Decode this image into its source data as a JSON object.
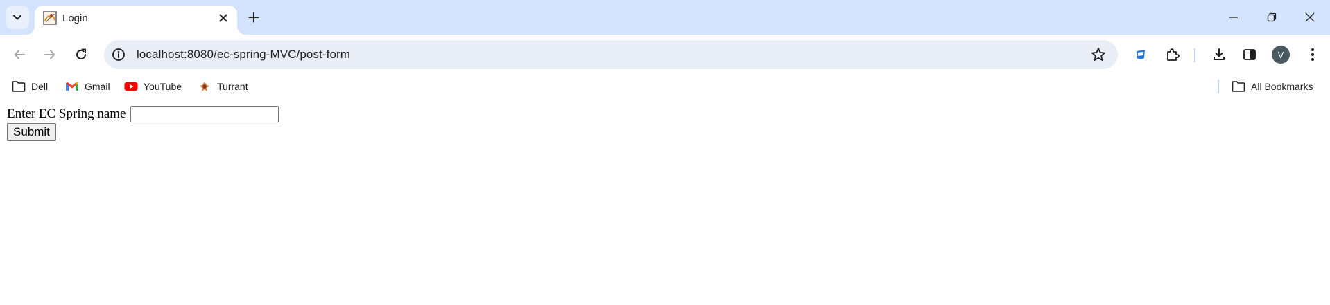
{
  "tab": {
    "title": "Login"
  },
  "omnibox": {
    "url": "localhost:8080/ec-spring-MVC/post-form"
  },
  "profile": {
    "initial": "V"
  },
  "bookmarks": {
    "items": [
      {
        "label": "Dell",
        "icon": "folder-icon"
      },
      {
        "label": "Gmail",
        "icon": "gmail-icon"
      },
      {
        "label": "YouTube",
        "icon": "youtube-icon"
      },
      {
        "label": "Turrant",
        "icon": "turrant-icon"
      }
    ],
    "all_label": "All Bookmarks"
  },
  "form": {
    "label": "Enter EC Spring name",
    "input_value": "",
    "submit_label": "Submit"
  },
  "colors": {
    "tabstrip": "#d3e3fd",
    "omnibox": "#e9eef6",
    "avatar": "#4a5a60"
  }
}
